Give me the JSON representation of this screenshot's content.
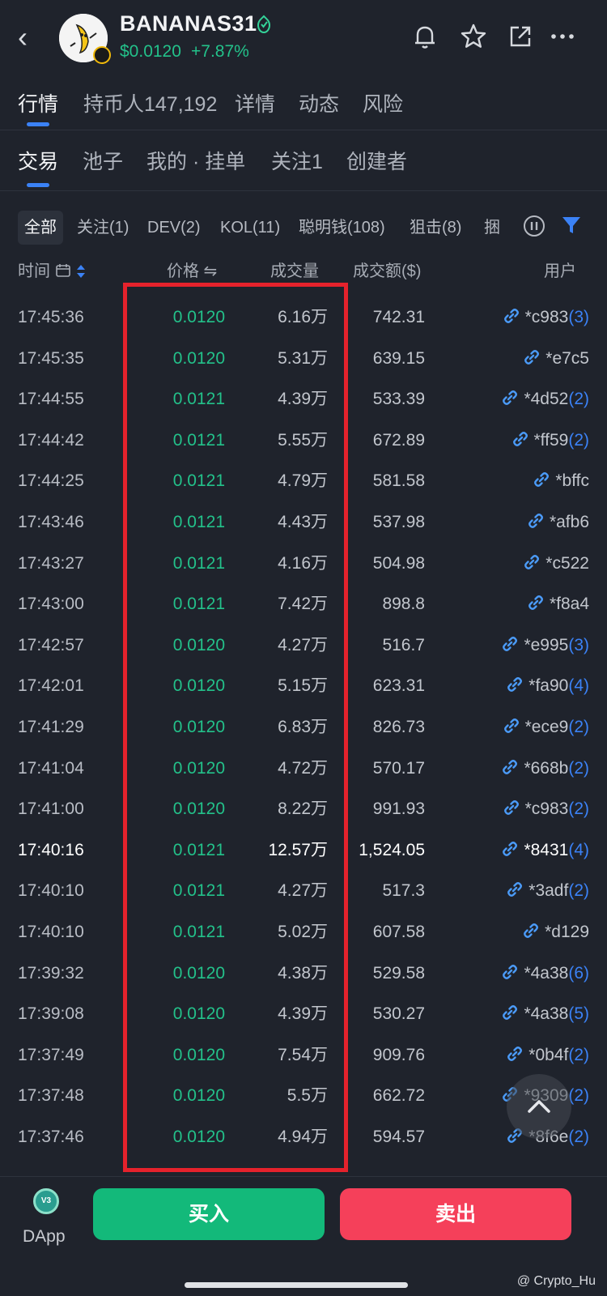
{
  "header": {
    "back_glyph": "‹",
    "coin_name": "BANANAS31",
    "price": "$0.0120",
    "change": "+7.87%",
    "icons": [
      "back-icon",
      "verified-icon",
      "bell-icon",
      "star-icon",
      "share-icon",
      "more-icon"
    ]
  },
  "tabs_primary": [
    {
      "label": "行情",
      "active": true
    },
    {
      "label": "持币人147,192",
      "active": false
    },
    {
      "label": "详情",
      "active": false
    },
    {
      "label": "动态",
      "active": false
    },
    {
      "label": "风险",
      "active": false
    }
  ],
  "tabs_secondary": [
    {
      "label": "交易",
      "active": true
    },
    {
      "label": "池子",
      "active": false
    },
    {
      "label": "我的 · 挂单",
      "active": false
    },
    {
      "label": "关注1",
      "active": false
    },
    {
      "label": "创建者",
      "active": false
    }
  ],
  "filters": [
    {
      "label": "全部",
      "active": true
    },
    {
      "label": "关注(1)"
    },
    {
      "label": "DEV(2)"
    },
    {
      "label": "KOL(11)"
    },
    {
      "label": "聪明钱(108)"
    },
    {
      "label": "狙击(8)"
    },
    {
      "label": "捆"
    }
  ],
  "columns": {
    "time": "时间",
    "price": "价格 ⇋",
    "volume": "成交量",
    "amount": "成交额($)",
    "user": "用户"
  },
  "trades": [
    {
      "time": "17:45:36",
      "price": "0.0120",
      "volume": "6.16万",
      "amount": "742.31",
      "user": "*c983",
      "count": "(3)"
    },
    {
      "time": "17:45:35",
      "price": "0.0120",
      "volume": "5.31万",
      "amount": "639.15",
      "user": "*e7c5",
      "count": ""
    },
    {
      "time": "17:44:55",
      "price": "0.0121",
      "volume": "4.39万",
      "amount": "533.39",
      "user": "*4d52",
      "count": "(2)"
    },
    {
      "time": "17:44:42",
      "price": "0.0121",
      "volume": "5.55万",
      "amount": "672.89",
      "user": "*ff59",
      "count": "(2)"
    },
    {
      "time": "17:44:25",
      "price": "0.0121",
      "volume": "4.79万",
      "amount": "581.58",
      "user": "*bffc",
      "count": ""
    },
    {
      "time": "17:43:46",
      "price": "0.0121",
      "volume": "4.43万",
      "amount": "537.98",
      "user": "*afb6",
      "count": ""
    },
    {
      "time": "17:43:27",
      "price": "0.0121",
      "volume": "4.16万",
      "amount": "504.98",
      "user": "*c522",
      "count": ""
    },
    {
      "time": "17:43:00",
      "price": "0.0121",
      "volume": "7.42万",
      "amount": "898.8",
      "user": "*f8a4",
      "count": ""
    },
    {
      "time": "17:42:57",
      "price": "0.0120",
      "volume": "4.27万",
      "amount": "516.7",
      "user": "*e995",
      "count": "(3)"
    },
    {
      "time": "17:42:01",
      "price": "0.0120",
      "volume": "5.15万",
      "amount": "623.31",
      "user": "*fa90",
      "count": "(4)"
    },
    {
      "time": "17:41:29",
      "price": "0.0120",
      "volume": "6.83万",
      "amount": "826.73",
      "user": "*ece9",
      "count": "(2)"
    },
    {
      "time": "17:41:04",
      "price": "0.0120",
      "volume": "4.72万",
      "amount": "570.17",
      "user": "*668b",
      "count": "(2)"
    },
    {
      "time": "17:41:00",
      "price": "0.0120",
      "volume": "8.22万",
      "amount": "991.93",
      "user": "*c983",
      "count": "(2)"
    },
    {
      "time": "17:40:16",
      "price": "0.0121",
      "volume": "12.57万",
      "amount": "1,524.05",
      "user": "*8431",
      "count": "(4)",
      "highlight": true
    },
    {
      "time": "17:40:10",
      "price": "0.0121",
      "volume": "4.27万",
      "amount": "517.3",
      "user": "*3adf",
      "count": "(2)"
    },
    {
      "time": "17:40:10",
      "price": "0.0121",
      "volume": "5.02万",
      "amount": "607.58",
      "user": "*d129",
      "count": ""
    },
    {
      "time": "17:39:32",
      "price": "0.0120",
      "volume": "4.38万",
      "amount": "529.58",
      "user": "*4a38",
      "count": "(6)"
    },
    {
      "time": "17:39:08",
      "price": "0.0120",
      "volume": "4.39万",
      "amount": "530.27",
      "user": "*4a38",
      "count": "(5)"
    },
    {
      "time": "17:37:49",
      "price": "0.0120",
      "volume": "7.54万",
      "amount": "909.76",
      "user": "*0b4f",
      "count": "(2)"
    },
    {
      "time": "17:37:48",
      "price": "0.0120",
      "volume": "5.5万",
      "amount": "662.72",
      "user": "*9309",
      "count": "(2)"
    },
    {
      "time": "17:37:46",
      "price": "0.0120",
      "volume": "4.94万",
      "amount": "594.57",
      "user": "*8f6e",
      "count": "(2)"
    }
  ],
  "bottom": {
    "dapp_logo": "V3",
    "dapp_label": "DApp",
    "buy_label": "买入",
    "sell_label": "卖出",
    "watermark": "@ Crypto_Hu"
  },
  "colors": {
    "background": "#1f232c",
    "up_green": "#23c18a",
    "accent_blue": "#3b82f6",
    "buy_button": "#13b97a",
    "sell_button": "#f5405a",
    "annotation_red": "#e5222c"
  }
}
